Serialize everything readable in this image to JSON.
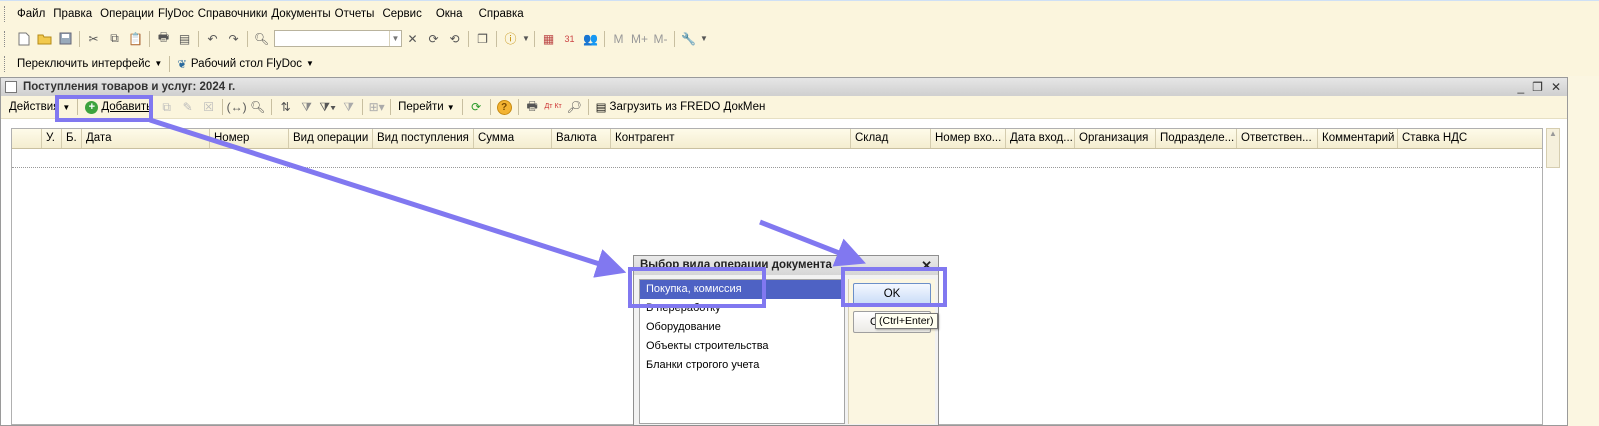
{
  "menu": {
    "items": [
      "Файл",
      "Правка",
      "Операции",
      "FlyDoc",
      "Справочники",
      "Документы",
      "Отчеты",
      "Сервис",
      "Окна",
      "Справка"
    ]
  },
  "toolbar2": {
    "interface_switch": "Переключить интерфейс",
    "desktop": "Рабочий стол FlyDoc"
  },
  "toolbar1": {
    "m_labels": [
      "M",
      "M+",
      "M-"
    ]
  },
  "window": {
    "title": "Поступления товаров и услуг: 2024 г.",
    "actions_label": "Действия",
    "add_label": "Добавить",
    "goto_label": "Перейти",
    "load_label": "Загрузить из FREDO ДокМен",
    "dtkt_label": "Дт Кт"
  },
  "table": {
    "columns": [
      "",
      "У.",
      "Б.",
      "Дата",
      "Номер",
      "Вид операции",
      "Вид поступления",
      "Сумма",
      "Валюта",
      "Контрагент",
      "Склад",
      "Номер вхо...",
      "Дата вход...",
      "Организация",
      "Подразделе...",
      "Ответствен...",
      "Комментарий",
      "Ставка НДС"
    ]
  },
  "dialog": {
    "title": "Выбор вида операции документа",
    "items": [
      "Покупка, комиссия",
      "В переработку",
      "Оборудование",
      "Объекты строительства",
      "Бланки строгого учета"
    ],
    "selected_index": 0,
    "ok_label": "OK",
    "cancel_label": "Отмена",
    "tooltip": "(Ctrl+Enter)"
  },
  "colors": {
    "highlight": "#8178f0",
    "selection": "#4e62c4",
    "background": "#fbf6e1"
  }
}
